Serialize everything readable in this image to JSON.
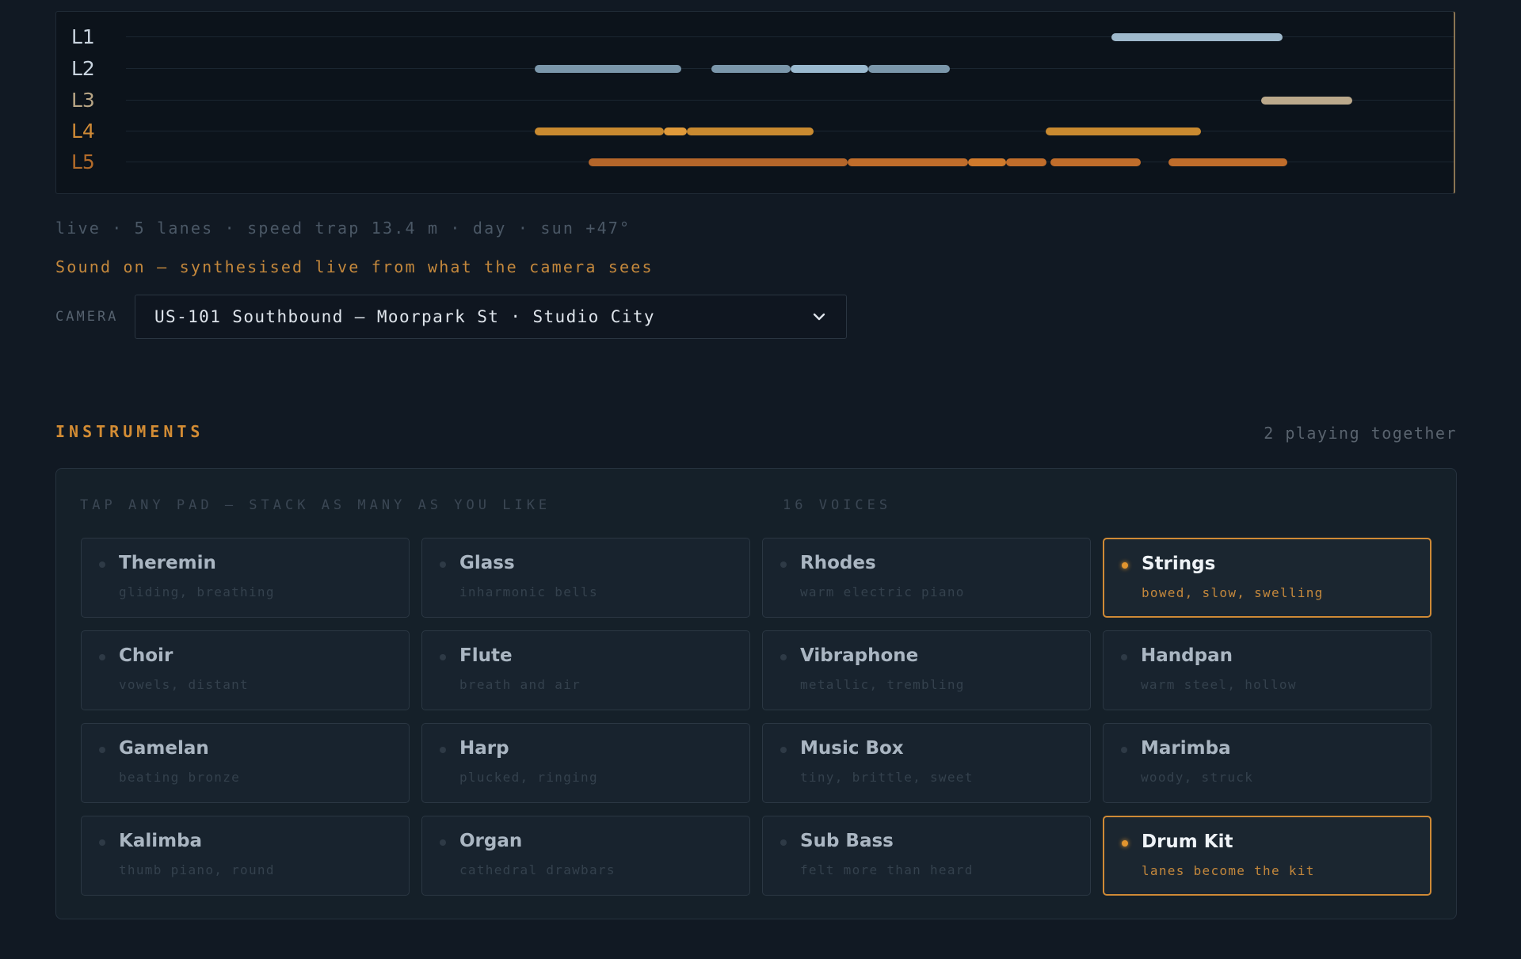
{
  "visualiser": {
    "lanes": [
      {
        "label": "L1",
        "color": "#c9d4df",
        "segments": [
          {
            "start": 0.7418,
            "end": 0.8704,
            "color": "#9fb9cc"
          }
        ]
      },
      {
        "label": "L2",
        "color": "#c9d4df",
        "segments": [
          {
            "start": 0.3077,
            "end": 0.4182,
            "color": "#7b97ab"
          },
          {
            "start": 0.4405,
            "end": 0.5002,
            "color": "#7b97ab"
          },
          {
            "start": 0.5002,
            "end": 0.5589,
            "color": "#9ab9cf"
          },
          {
            "start": 0.5589,
            "end": 0.6202,
            "color": "#7b97ab"
          }
        ]
      },
      {
        "label": "L3",
        "color": "#b8a585",
        "segments": [
          {
            "start": 0.8548,
            "end": 0.9233,
            "color": "#bba98c"
          }
        ]
      },
      {
        "label": "L4",
        "color": "#cf8a36",
        "segments": [
          {
            "start": 0.3077,
            "end": 0.4046,
            "color": "#c98a30"
          },
          {
            "start": 0.4046,
            "end": 0.4224,
            "color": "#e09a3a"
          },
          {
            "start": 0.4224,
            "end": 0.5178,
            "color": "#c98a30"
          },
          {
            "start": 0.6926,
            "end": 0.8094,
            "color": "#c98a30"
          }
        ]
      },
      {
        "label": "L5",
        "color": "#b36b2a",
        "segments": [
          {
            "start": 0.3483,
            "end": 0.5433,
            "color": "#b5662a"
          },
          {
            "start": 0.5433,
            "end": 0.6336,
            "color": "#c06d2b"
          },
          {
            "start": 0.6336,
            "end": 0.6626,
            "color": "#d07a2c"
          },
          {
            "start": 0.6626,
            "end": 0.6927,
            "color": "#c06d2b"
          },
          {
            "start": 0.696,
            "end": 0.764,
            "color": "#c06d2b"
          },
          {
            "start": 0.785,
            "end": 0.8739,
            "color": "#c06d2b"
          }
        ]
      }
    ]
  },
  "status": "live · 5 lanes · speed trap 13.4 m · day · sun +47°",
  "sound": "Sound on — synthesised live from what the camera sees",
  "camera": {
    "label": "CAMERA",
    "selected": "US-101 Southbound — Moorpark St · Studio City"
  },
  "instruments": {
    "title": "INSTRUMENTS",
    "playing": "2 playing together",
    "hint": "TAP ANY PAD — STACK AS MANY AS YOU LIKE",
    "voices": "16 VOICES",
    "pads": [
      {
        "name": "Theremin",
        "desc": "gliding, breathing",
        "active": false
      },
      {
        "name": "Glass",
        "desc": "inharmonic bells",
        "active": false
      },
      {
        "name": "Rhodes",
        "desc": "warm electric piano",
        "active": false
      },
      {
        "name": "Strings",
        "desc": "bowed, slow, swelling",
        "active": true
      },
      {
        "name": "Choir",
        "desc": "vowels, distant",
        "active": false
      },
      {
        "name": "Flute",
        "desc": "breath and air",
        "active": false
      },
      {
        "name": "Vibraphone",
        "desc": "metallic, trembling",
        "active": false
      },
      {
        "name": "Handpan",
        "desc": "warm steel, hollow",
        "active": false
      },
      {
        "name": "Gamelan",
        "desc": "beating bronze",
        "active": false
      },
      {
        "name": "Harp",
        "desc": "plucked, ringing",
        "active": false
      },
      {
        "name": "Music Box",
        "desc": "tiny, brittle, sweet",
        "active": false
      },
      {
        "name": "Marimba",
        "desc": "woody, struck",
        "active": false
      },
      {
        "name": "Kalimba",
        "desc": "thumb piano, round",
        "active": false
      },
      {
        "name": "Organ",
        "desc": "cathedral drawbars",
        "active": false
      },
      {
        "name": "Sub Bass",
        "desc": "felt more than heard",
        "active": false
      },
      {
        "name": "Drum Kit",
        "desc": "lanes become the kit",
        "active": true
      }
    ]
  }
}
